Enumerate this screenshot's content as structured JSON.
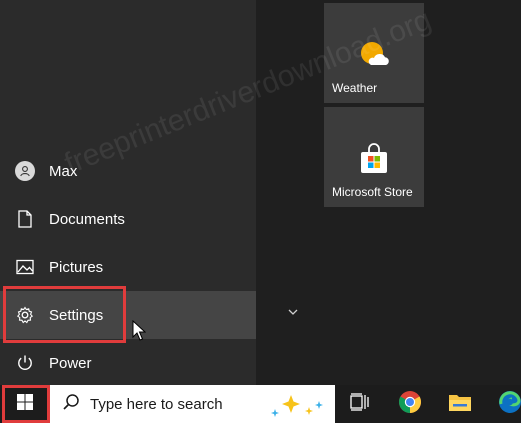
{
  "start_menu": {
    "items": [
      {
        "label": "Max",
        "icon": "user-avatar-icon"
      },
      {
        "label": "Documents",
        "icon": "document-icon"
      },
      {
        "label": "Pictures",
        "icon": "picture-icon"
      },
      {
        "label": "Settings",
        "icon": "gear-icon"
      },
      {
        "label": "Power",
        "icon": "power-icon"
      }
    ]
  },
  "tiles": [
    {
      "label": "Weather",
      "icon": "weather-sun-cloud-icon"
    },
    {
      "label": "Microsoft Store",
      "icon": "store-bag-icon"
    }
  ],
  "taskbar": {
    "search_placeholder": "Type here to search",
    "apps": [
      "task-view-icon",
      "chrome-icon",
      "file-explorer-icon",
      "edge-icon"
    ]
  },
  "watermark": "freeprinterdriverdownload.org",
  "colors": {
    "highlight": "#e03c3c",
    "menu_bg": "#2b2b2b",
    "hover_bg": "#454545",
    "tile_bg": "#3c3c3c",
    "taskbar_bg": "#1c1c1c"
  }
}
